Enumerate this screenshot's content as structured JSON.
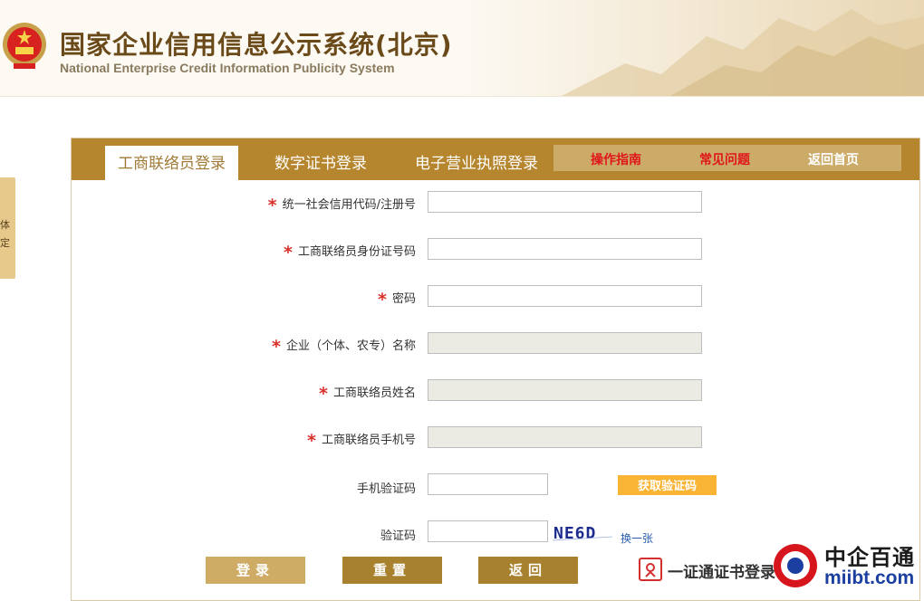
{
  "header": {
    "title_cn": "国家企业信用信息公示系统(北京)",
    "title_en": "National Enterprise Credit Information Publicity System"
  },
  "side_tab": {
    "text_1": "体",
    "text_2": "定"
  },
  "tabs": [
    {
      "label": "工商联络员登录",
      "active": true
    },
    {
      "label": "数字证书登录",
      "active": false
    },
    {
      "label": "电子营业执照登录",
      "active": false
    }
  ],
  "links": {
    "guide": "操作指南",
    "faq": "常见问题",
    "home": "返回首页"
  },
  "form": {
    "credit_code": {
      "label": "统一社会信用代码/注册号",
      "required": true,
      "value": ""
    },
    "id_number": {
      "label": "工商联络员身份证号码",
      "required": true,
      "value": ""
    },
    "password": {
      "label": "密码",
      "required": true,
      "value": ""
    },
    "enterprise_name": {
      "label": "企业（个体、农专）名称",
      "required": true,
      "value": "",
      "disabled": true
    },
    "contact_name": {
      "label": "工商联络员姓名",
      "required": true,
      "value": "",
      "disabled": true
    },
    "contact_phone": {
      "label": "工商联络员手机号",
      "required": true,
      "value": "",
      "disabled": true
    },
    "sms_code": {
      "label": "手机验证码",
      "required": false,
      "value": ""
    },
    "captcha": {
      "label": "验证码",
      "required": false,
      "value": ""
    },
    "required_mark": "*"
  },
  "sms_button": "获取验证码",
  "captcha_text": "NE6D",
  "refresh_label": "换一张",
  "buttons": {
    "login": "登录",
    "reset": "重置",
    "back": "返回"
  },
  "cert_link": "一证通证书登录",
  "watermark": {
    "cn": "中企百通",
    "en": "miibt.com"
  },
  "colors": {
    "brand_gold": "#b6862e",
    "links_bg": "#ccaa68",
    "link_red": "#e0161b",
    "sms_orange": "#f9b335"
  }
}
